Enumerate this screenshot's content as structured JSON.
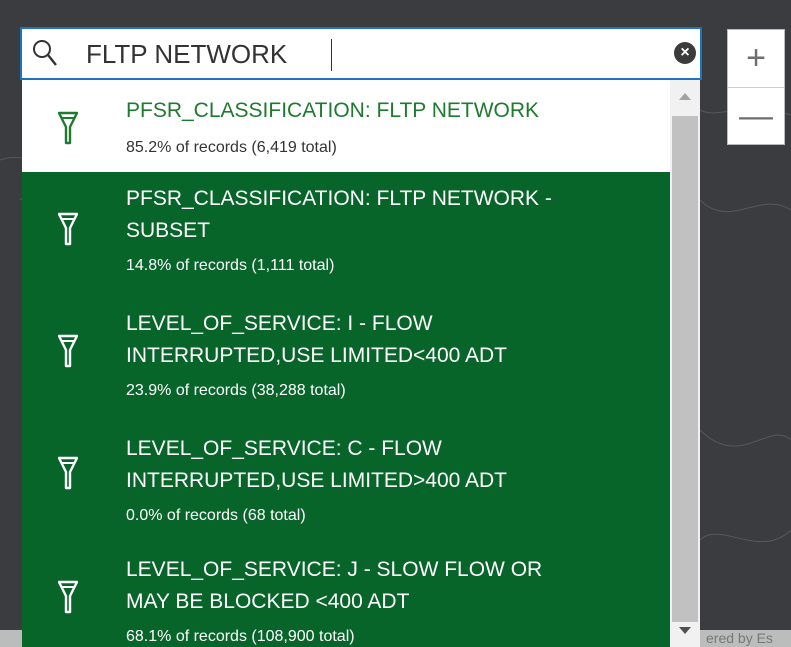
{
  "search": {
    "query": "FLTP NETWORK",
    "clear_symbol": "×"
  },
  "zoom": {
    "zoom_in": "+",
    "zoom_out": "—"
  },
  "attribution": {
    "text": "ered by Es"
  },
  "suggestions": [
    {
      "title": "PFSR_CLASSIFICATION: FLTP NETWORK",
      "subtitle": "85.2% of records (6,419 total)",
      "icon": "filter-icon",
      "highlighted": false
    },
    {
      "title": "PFSR_CLASSIFICATION: FLTP NETWORK -\nSUBSET",
      "subtitle": "14.8% of records (1,111 total)",
      "icon": "filter-icon",
      "highlighted": true
    },
    {
      "title": "LEVEL_OF_SERVICE: I - FLOW\nINTERRUPTED,USE LIMITED<400 ADT",
      "subtitle": "23.9% of records (38,288 total)",
      "icon": "filter-icon",
      "highlighted": true
    },
    {
      "title": "LEVEL_OF_SERVICE: C - FLOW\nINTERRUPTED,USE LIMITED>400 ADT",
      "subtitle": "0.0% of records (68 total)",
      "icon": "filter-icon",
      "highlighted": true
    },
    {
      "title": "LEVEL_OF_SERVICE: J - SLOW FLOW OR\nMAY BE BLOCKED <400 ADT",
      "subtitle": "68.1% of records (108,900 total)",
      "icon": "filter-icon",
      "highlighted": true
    }
  ],
  "colors": {
    "accent_blue": "#1c73c2",
    "highlight_green": "#07652a",
    "first_title_green": "#1e7a2f",
    "map_dark": "#3a3c3f"
  }
}
